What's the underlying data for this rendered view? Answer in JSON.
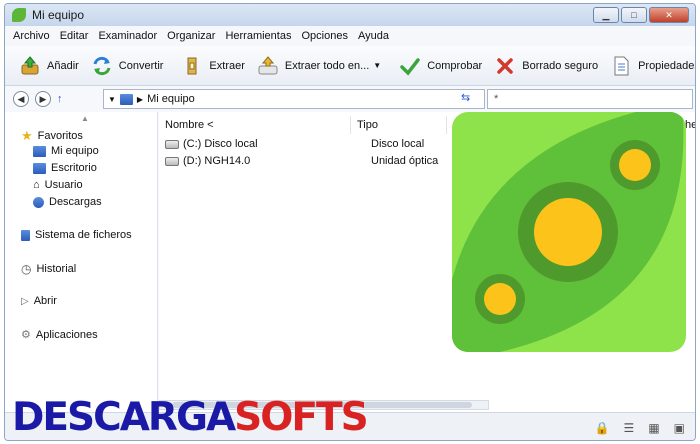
{
  "window": {
    "title": "Mi equipo"
  },
  "menu": [
    "Archivo",
    "Editar",
    "Examinador",
    "Organizar",
    "Herramientas",
    "Opciones",
    "Ayuda"
  ],
  "toolbar": {
    "add": "Añadir",
    "convert": "Convertir",
    "extract": "Extraer",
    "extract_all": "Extraer todo en...",
    "test": "Comprobar",
    "secure_delete": "Borrado seguro",
    "properties": "Propiedades"
  },
  "address": {
    "path": "Mi equipo",
    "search_placeholder": "*"
  },
  "sidebar": {
    "favorites": "Favoritos",
    "favorites_items": [
      "Mi equipo",
      "Escritorio",
      "Usuario",
      "Descargas"
    ],
    "filesystem": "Sistema de ficheros",
    "history": "Historial",
    "open": "Abrir",
    "apps": "Aplicaciones"
  },
  "columns": {
    "name": "Nombre <",
    "type": "Tipo",
    "extra": "he"
  },
  "rows": [
    {
      "name": "(C:) Disco local",
      "type": "Disco local"
    },
    {
      "name": "(D:) NGH14.0",
      "type": "Unidad óptica"
    }
  ],
  "watermark": {
    "part1": "DESCARGA",
    "part2": "SOFTS"
  },
  "colors": {
    "logo_green": "#8ee34b",
    "logo_dark": "#4f9a2c",
    "logo_yellow": "#fcc41a",
    "wm_blue": "#1a1aa6",
    "wm_red": "#d92323"
  }
}
